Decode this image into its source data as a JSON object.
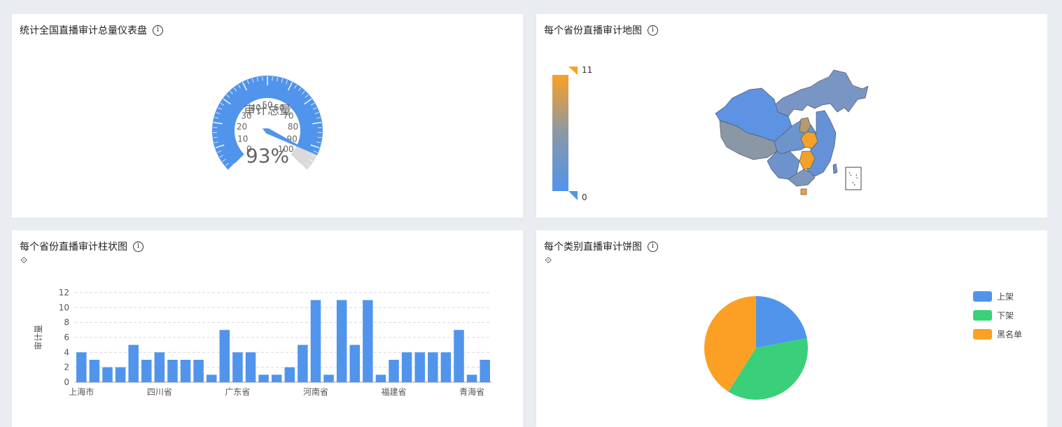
{
  "panels": {
    "gauge": {
      "title": "统计全国直播审计总量仪表盘"
    },
    "map": {
      "title": "每个省份直播审计地图"
    },
    "bar": {
      "title": "每个省份直播审计柱状图"
    },
    "pie": {
      "title": "每个类别直播审计饼图"
    }
  },
  "icons": {
    "info": "info-circle-icon",
    "toolbox": "restore-icon",
    "info_glyph": "i",
    "toolbox_glyph": "⟐"
  },
  "colors": {
    "blue": "#5194ec",
    "green": "#3ad07a",
    "orange": "#fba025",
    "gray": "#8a98a6",
    "pointer": "#5194ec"
  },
  "chart_data": [
    {
      "type": "gauge",
      "title": "审计总量",
      "value": 93,
      "value_label": "93%",
      "min": 0,
      "max": 100,
      "tick_labels": [
        "0",
        "10",
        "20",
        "30",
        "40",
        "50",
        "60",
        "70",
        "80",
        "90",
        "100"
      ]
    },
    {
      "type": "map",
      "region": "China",
      "visual_map": {
        "min": 0,
        "max": 11,
        "min_label": "0",
        "max_label": "11",
        "colors": [
          "#5194ec",
          "#8a98a6",
          "#fba025"
        ]
      }
    },
    {
      "type": "bar",
      "ylabel": "审计量",
      "ylim": [
        0,
        12
      ],
      "yticks": [
        0,
        2,
        4,
        6,
        8,
        10,
        12
      ],
      "visible_category_labels": [
        {
          "index": 0,
          "label": "上海市"
        },
        {
          "index": 6,
          "label": "四川省"
        },
        {
          "index": 12,
          "label": "广东省"
        },
        {
          "index": 18,
          "label": "河南省"
        },
        {
          "index": 24,
          "label": "福建省"
        },
        {
          "index": 30,
          "label": "青海省"
        }
      ],
      "values": [
        4,
        3,
        2,
        2,
        5,
        3,
        4,
        3,
        3,
        3,
        1,
        7,
        4,
        4,
        1,
        1,
        2,
        5,
        11,
        1,
        11,
        5,
        11,
        1,
        3,
        4,
        4,
        4,
        4,
        7,
        1,
        3
      ]
    },
    {
      "type": "pie",
      "series": [
        {
          "name": "上架",
          "value": 22,
          "color": "#5194ec"
        },
        {
          "name": "下架",
          "value": 37,
          "color": "#3ad07a"
        },
        {
          "name": "黑名单",
          "value": 41,
          "color": "#fba025"
        }
      ],
      "legend_position": "right"
    }
  ]
}
